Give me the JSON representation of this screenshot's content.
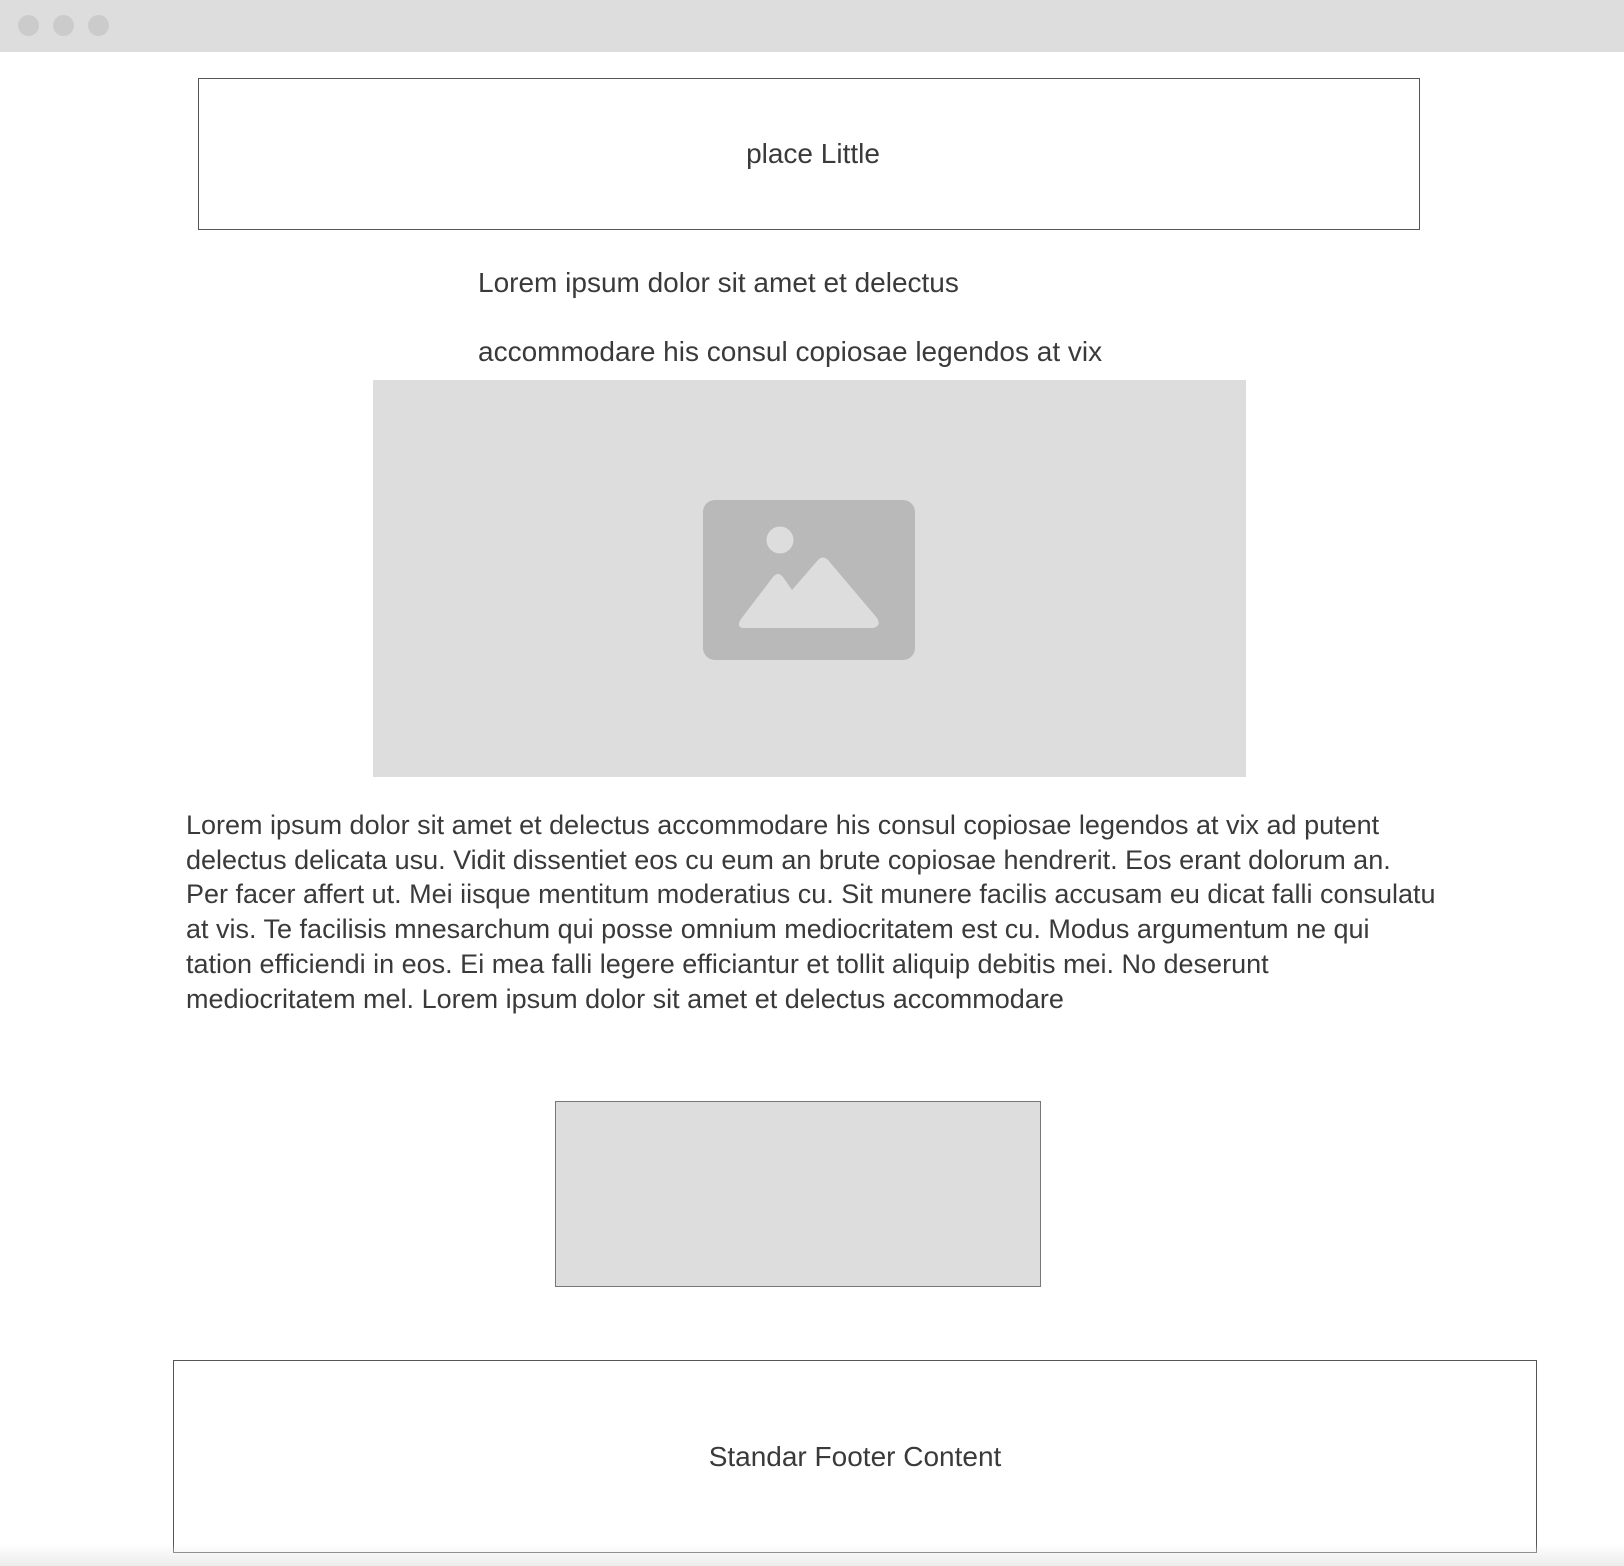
{
  "header": {
    "title": "place Little"
  },
  "intro": {
    "line1": "Lorem ipsum dolor sit amet et delectus",
    "line2": "accommodare his consul copiosae legendos at vix"
  },
  "hero_image": {
    "icon": "image-placeholder-icon"
  },
  "body": {
    "paragraph": "Lorem ipsum dolor sit amet et delectus accommodare his consul copiosae legendos at vix ad putent delectus delicata usu. Vidit dissentiet eos cu eum an brute copiosae hendrerit. Eos erant dolorum an. Per facer affert ut. Mei iisque mentitum moderatius cu. Sit munere facilis accusam eu dicat falli consulatu at vis. Te facilisis mnesarchum qui posse omnium mediocritatem est cu. Modus argumentum ne qui tation efficiendi in eos. Ei mea falli legere efficiantur et tollit aliquip debitis mei. No deserunt mediocritatem mel. Lorem ipsum dolor sit amet et delectus accommodare"
  },
  "footer": {
    "text": "Standar Footer Content"
  },
  "colors": {
    "titlebar": "#dddddd",
    "window_dot": "#cbcbcb",
    "placeholder_fill": "#dddddd",
    "icon_fill": "#b9b9b9",
    "text": "#3a3a3a",
    "border": "#555555"
  }
}
